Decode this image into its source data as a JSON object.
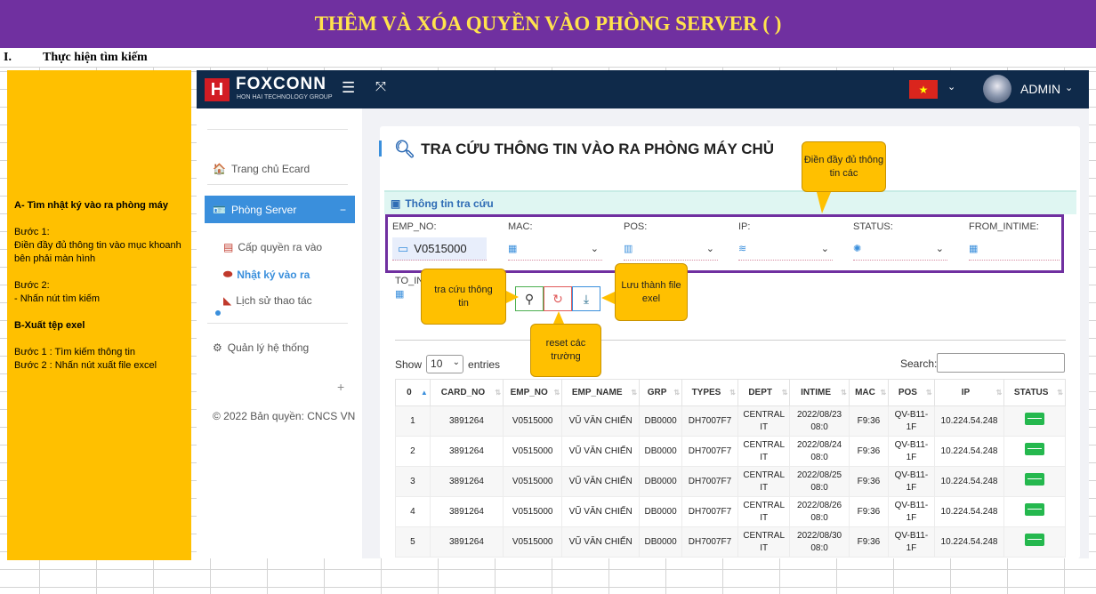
{
  "doc_title": "THÊM VÀ XÓA QUYỀN VÀO PHÒNG SERVER ( )",
  "section": {
    "num": "I.",
    "title": "Thực hiện tìm kiếm"
  },
  "note": {
    "a_heading": "A- Tìm nhật ký vào ra phòng máy",
    "step1_label": "Bước 1:",
    "step1_text": "Điền đầy đủ thông tin vào mục khoanh bên phải màn hình",
    "step2_label": "Bước 2:",
    "step2_text": "- Nhấn nút tìm kiếm",
    "b_heading": "B-Xuất tệp exel",
    "b_step1": "Bước 1 : Tìm kiếm thông tin",
    "b_step2": "Bước 2 : Nhấn nút xuất file excel"
  },
  "topbar": {
    "brand": "FOXCONN",
    "brand_sub": "HON HAI TECHNOLOGY GROUP",
    "user": "ADMIN"
  },
  "sidebar": {
    "home": "Trang chủ Ecard",
    "server_room": "Phòng Server",
    "sub_grant": "Cấp quyền ra vào",
    "sub_log": "Nhật ký vào ra",
    "sub_history": "Lịch sử thao tác",
    "settings": "Quản lý hệ thống",
    "copyright": "© 2022 Bản quyền: CNCS VN"
  },
  "main": {
    "title": "TRA CỨU THÔNG TIN VÀO RA PHÒNG MÁY CHỦ",
    "panel": "Thông tin tra cứu",
    "fields": {
      "emp_no_label": "EMP_NO:",
      "emp_no_value": "V0515000",
      "mac_label": "MAC:",
      "pos_label": "POS:",
      "ip_label": "IP:",
      "status_label": "STATUS:",
      "from_label": "FROM_INTIME:",
      "to_label": "TO_IN"
    },
    "show": "Show",
    "show_value": "10",
    "entries": "entries",
    "search": "Search:"
  },
  "table": {
    "headers": [
      "0",
      "CARD_NO",
      "EMP_NO",
      "EMP_NAME",
      "GRP",
      "TYPES",
      "DEPT",
      "INTIME",
      "MAC",
      "POS",
      "IP",
      "STATUS"
    ],
    "rows": [
      [
        "1",
        "3891264",
        "V0515000",
        "VŨ VĂN CHIẾN",
        "DB0000",
        "DH7007F7",
        "CENTRAL IT",
        "2022/08/23 08:0",
        "F9:36",
        "QV-B11-1F",
        "10.224.54.248"
      ],
      [
        "2",
        "3891264",
        "V0515000",
        "VŨ VĂN CHIẾN",
        "DB0000",
        "DH7007F7",
        "CENTRAL IT",
        "2022/08/24 08:0",
        "F9:36",
        "QV-B11-1F",
        "10.224.54.248"
      ],
      [
        "3",
        "3891264",
        "V0515000",
        "VŨ VĂN CHIẾN",
        "DB0000",
        "DH7007F7",
        "CENTRAL IT",
        "2022/08/25 08:0",
        "F9:36",
        "QV-B11-1F",
        "10.224.54.248"
      ],
      [
        "4",
        "3891264",
        "V0515000",
        "VŨ VĂN CHIẾN",
        "DB0000",
        "DH7007F7",
        "CENTRAL IT",
        "2022/08/26 08:0",
        "F9:36",
        "QV-B11-1F",
        "10.224.54.248"
      ],
      [
        "5",
        "3891264",
        "V0515000",
        "VŨ VĂN CHIẾN",
        "DB0000",
        "DH7007F7",
        "CENTRAL IT",
        "2022/08/30 08:0",
        "F9:36",
        "QV-B11-1F",
        "10.224.54.248"
      ]
    ]
  },
  "callouts": {
    "fill_info": "Điền đầy đủ thông tin các",
    "search_btn": "tra cứu thông tin",
    "save_excel": "Lưu thành file exel",
    "reset": "reset các trường"
  },
  "colors": {
    "banner": "#7030a0",
    "banner_text": "#ffe34d",
    "note_bg": "#ffc000",
    "topbar": "#0f2a4a",
    "accent": "#3a8fdc"
  }
}
